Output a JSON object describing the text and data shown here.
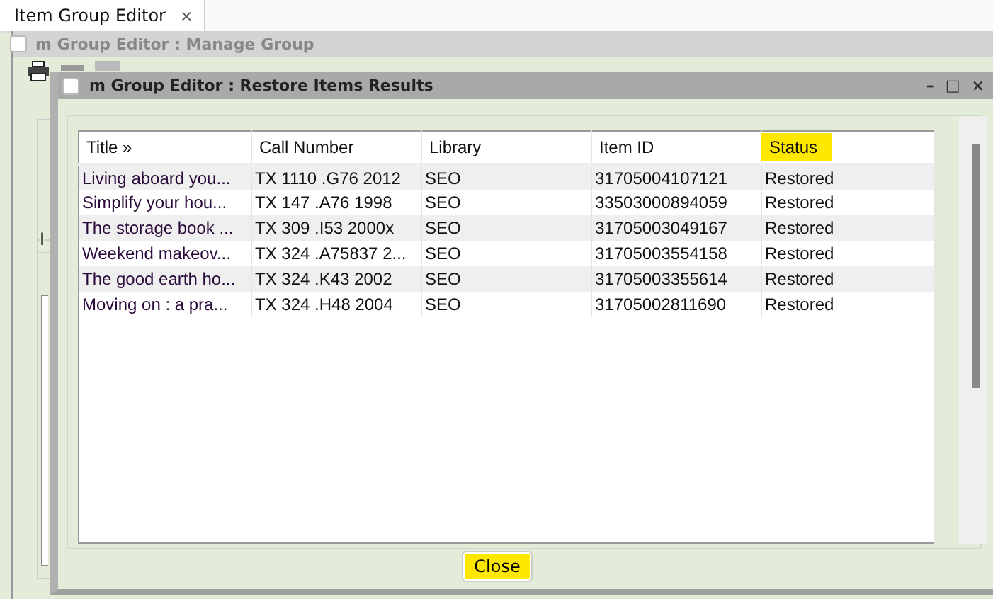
{
  "tab": {
    "label": "Item Group Editor",
    "close": "×"
  },
  "back_window": {
    "title": "m Group Editor : Manage Group",
    "checkbox": {
      "checked": false
    },
    "list_label": "I"
  },
  "window": {
    "title": "m Group Editor : Restore Items Results",
    "checkbox": {
      "checked": false
    },
    "controls": [
      "–",
      "□",
      "×"
    ]
  },
  "table": {
    "columns": [
      {
        "label": "Title »",
        "highlighted": false
      },
      {
        "label": "Call Number",
        "highlighted": false
      },
      {
        "label": "Library",
        "highlighted": false
      },
      {
        "label": "Item ID",
        "highlighted": false
      },
      {
        "label": "Status",
        "highlighted": true
      }
    ],
    "rows": [
      [
        "Living aboard you...",
        "TX 1110 .G76 2012",
        "SEO",
        "31705004107121",
        "Restored"
      ],
      [
        "Simplify your hou...",
        "TX 147 .A76 1998",
        "SEO",
        "33503000894059",
        "Restored"
      ],
      [
        "The storage book ...",
        "TX 309 .I53 2000x",
        "SEO",
        "31705003049167",
        "Restored"
      ],
      [
        "Weekend makeov...",
        "TX 324 .A75837 2...",
        "SEO",
        "31705003554158",
        "Restored"
      ],
      [
        "The good earth ho...",
        "TX 324 .K43 2002",
        "SEO",
        "31705003355614",
        "Restored"
      ],
      [
        "Moving on : a pra...",
        "TX 324 .H48 2004",
        "SEO",
        "31705002811690",
        "Restored"
      ]
    ]
  },
  "buttons": [
    {
      "label": "Close",
      "highlighted": true
    }
  ]
}
